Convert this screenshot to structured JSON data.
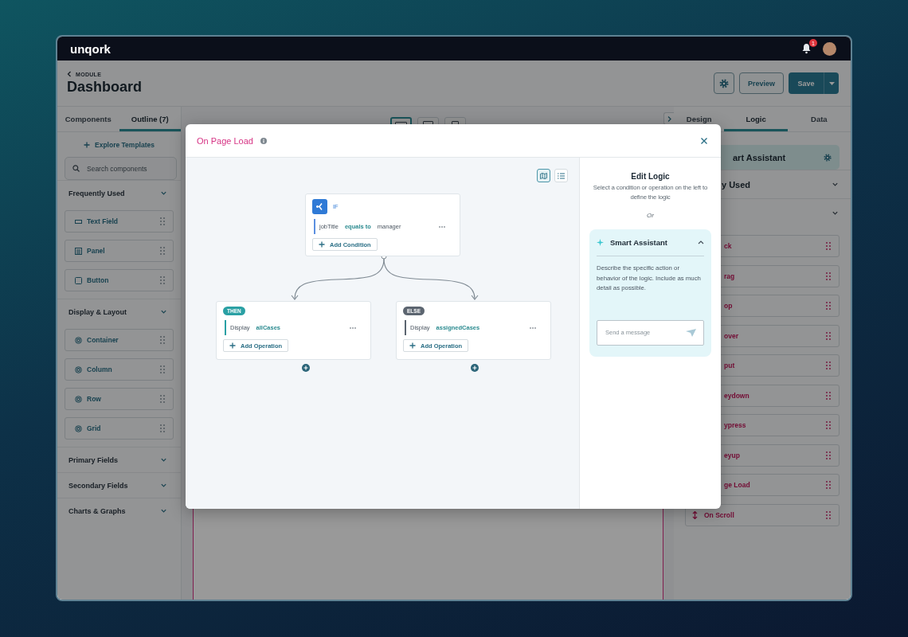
{
  "top_bar": {
    "logo": "unqork",
    "notifications": {
      "count": "1"
    }
  },
  "header": {
    "breadcrumb": "MODULE",
    "title": "Dashboard",
    "buttons": [
      {
        "kind": "settings"
      },
      {
        "kind": "secondary",
        "label": "Preview"
      },
      {
        "kind": "primary",
        "label": "Save"
      }
    ]
  },
  "left_panel": {
    "tabs": [
      {
        "label": "Components",
        "selected": false
      },
      {
        "label": "Outline (7)",
        "selected": true
      }
    ],
    "templates_link": "Explore Templates",
    "search": {
      "placeholder": "Search components"
    },
    "sections": [
      {
        "title": "Frequently Used",
        "items": [
          {
            "label": "Text Field",
            "kind": "input"
          },
          {
            "label": "Panel",
            "kind": "panel"
          },
          {
            "label": "Button",
            "kind": "button"
          }
        ]
      },
      {
        "title": "Display & Layout",
        "items": [
          {
            "label": "Container",
            "kind": "layout"
          },
          {
            "label": "Column",
            "kind": "layout"
          },
          {
            "label": "Row",
            "kind": "layout"
          },
          {
            "label": "Grid",
            "kind": "layout"
          }
        ]
      },
      {
        "title": "Primary Fields"
      },
      {
        "title": "Secondary Fields"
      },
      {
        "title": "Charts & Graphs"
      }
    ]
  },
  "canvas": {
    "device_buttons": [
      {
        "selected": true
      },
      {
        "selected": false
      },
      {
        "selected": false
      }
    ]
  },
  "right_panel": {
    "tabs": [
      {
        "label": "Design",
        "selected": false
      },
      {
        "label": "Logic",
        "selected": true
      },
      {
        "label": "Data",
        "selected": false
      }
    ],
    "assistant_bar": "art Assistant",
    "sections": [
      {
        "title": "y Used"
      },
      {
        "items": [
          {
            "label": "ck",
            "kind": "cut"
          },
          {
            "label": "rag",
            "kind": "cut"
          },
          {
            "label": "op",
            "kind": "cut"
          },
          {
            "label": "over",
            "kind": "cut"
          },
          {
            "label": "put",
            "kind": "cut"
          },
          {
            "label": "eydown",
            "kind": "cut"
          },
          {
            "label": "ypress",
            "kind": "cut"
          },
          {
            "label": "eyup",
            "kind": "cut"
          },
          {
            "label": "ge Load",
            "kind": "cut"
          },
          {
            "label": "On Scroll",
            "kind": "scroll"
          }
        ]
      }
    ]
  },
  "modal": {
    "title": "On Page Load",
    "view_toggles": [
      {
        "kind": "map",
        "selected": true
      },
      {
        "kind": "list",
        "selected": false
      }
    ],
    "flow": {
      "condition": {
        "label": "IF",
        "field": "jobTitle",
        "operator": "equals to",
        "value": "manager",
        "add_label": "Add Condition"
      },
      "branches": [
        {
          "kind": "then",
          "badge": "THEN",
          "action": "Display",
          "target": "allCases",
          "add_label": "Add Operation"
        },
        {
          "kind": "else",
          "badge": "ELSE",
          "action": "Display",
          "target": "assignedCases",
          "add_label": "Add Operation"
        }
      ]
    },
    "editor": {
      "title": "Edit Logic",
      "description": "Select a condition or operation on the left to define the logic",
      "separator": "Or",
      "assistant": {
        "title": "Smart Assistant",
        "expanded": true,
        "description": "Describe the specific action or behavior of the logic. Include as much detail as possible.",
        "input": {
          "placeholder": "Send a message"
        }
      }
    }
  }
}
